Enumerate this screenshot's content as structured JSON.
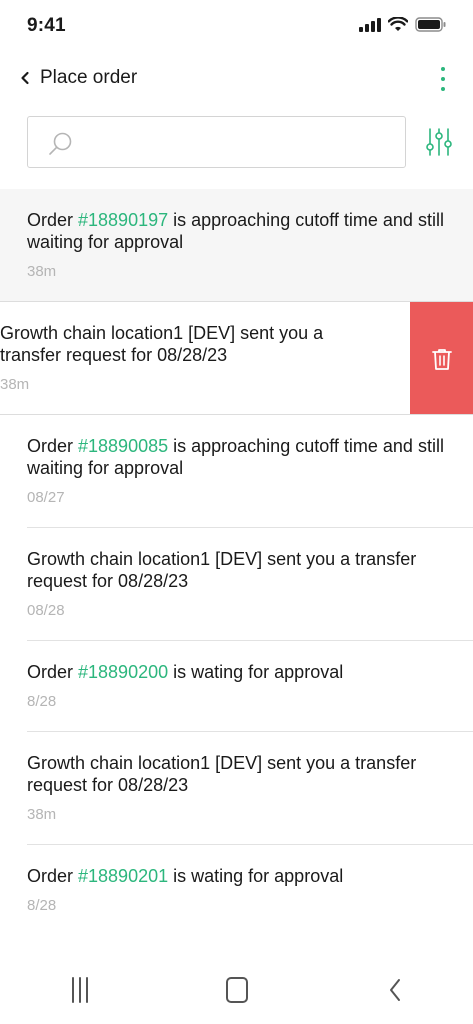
{
  "status_bar": {
    "time": "9:41"
  },
  "header": {
    "title": "Place order"
  },
  "search": {
    "placeholder": "",
    "value": ""
  },
  "notifications": [
    {
      "prefix": "Order ",
      "link": "#18890197",
      "suffix": " is approaching cutoff time and still waiting for approval",
      "time": "38m",
      "highlighted": true
    },
    {
      "prefix": "Growth chain location1 [DEV] sent you a transfer request for 08/28/23",
      "link": "",
      "suffix": "",
      "time": "38m",
      "swiped": true
    },
    {
      "prefix": "Order ",
      "link": "#18890085",
      "suffix": " is approaching cutoff time and still waiting for approval",
      "time": "08/27"
    },
    {
      "prefix": "Growth chain location1 [DEV] sent you a transfer request for 08/28/23",
      "link": "",
      "suffix": "",
      "time": "08/28"
    },
    {
      "prefix": "Order ",
      "link": "#18890200",
      "suffix": " is wating for approval",
      "time": "8/28"
    },
    {
      "prefix": "Growth chain location1 [DEV] sent you a transfer request for 08/28/23",
      "link": "",
      "suffix": "",
      "time": "38m"
    },
    {
      "prefix": "Order ",
      "link": "#18890201",
      "suffix": " is wating for approval",
      "time": "8/28"
    }
  ],
  "colors": {
    "accent": "#2cb67d",
    "delete": "#eb5a5a",
    "muted": "#b5b5b5"
  },
  "icons": {
    "back": "chevron-left-icon",
    "more": "more-vertical-icon",
    "search": "search-icon",
    "filter": "sliders-icon",
    "delete": "trash-icon"
  }
}
